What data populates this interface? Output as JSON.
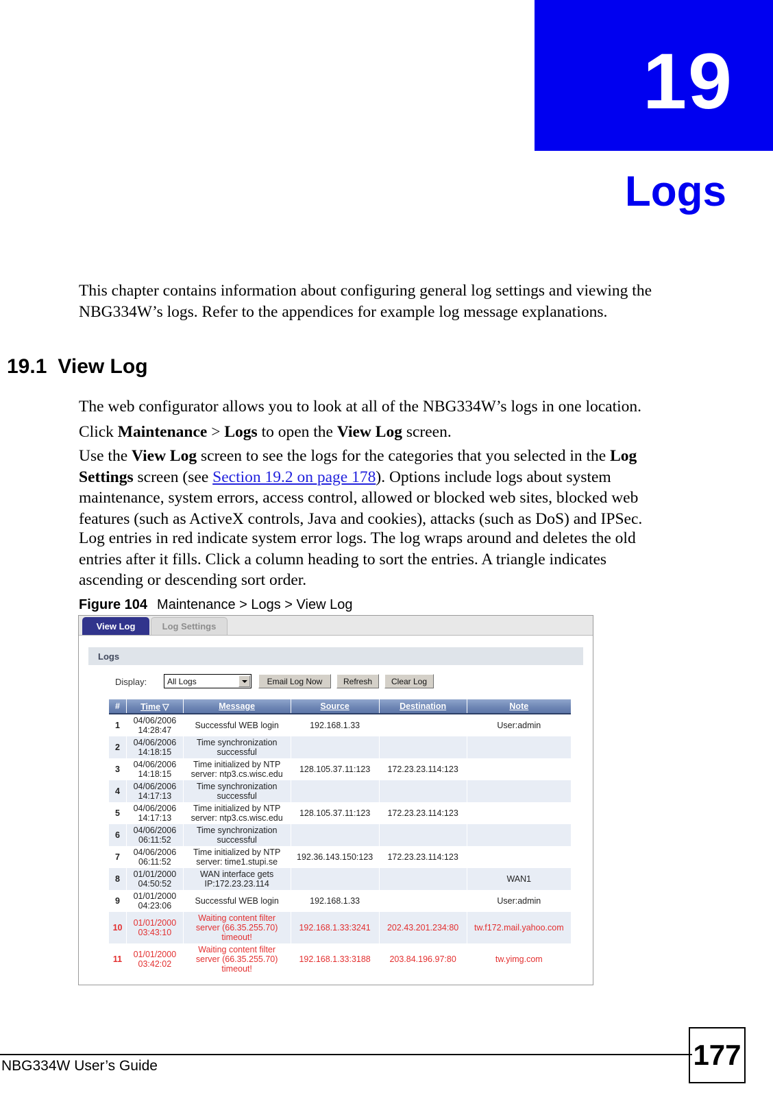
{
  "chapter": {
    "number": "19",
    "title": "Logs",
    "badge_color": "#0000f0"
  },
  "intro": "This chapter contains information about configuring general log settings and viewing the NBG334W’s logs. Refer to the appendices for example log message explanations.",
  "section": {
    "number": "19.1",
    "title": "View Log"
  },
  "paragraphs": {
    "p1": "The web configurator allows you to look at all of the NBG334W’s logs in one location.",
    "p2_a": "Click ",
    "p2_b": "Maintenance",
    "p2_c": " > ",
    "p2_d": "Logs",
    "p2_e": " to open the ",
    "p2_f": "View Log",
    "p2_g": " screen.",
    "p3_a": "Use the ",
    "p3_b": "View Log",
    "p3_c": " screen to see the logs for the categories that you selected in the ",
    "p3_d": "Log Settings",
    "p3_e": " screen (see ",
    "p3_link": "Section 19.2 on page 178",
    "p3_f": "). Options include logs about system maintenance, system errors, access control, allowed or blocked web sites, blocked web features (such as ActiveX controls, Java and cookies), attacks (such as DoS) and IPSec.",
    "p4": "Log entries in red indicate system error logs. The log wraps around and deletes the old entries after it fills. Click a column heading to sort the entries. A triangle indicates ascending or descending sort order."
  },
  "figure": {
    "label": "Figure 104",
    "caption": "Maintenance > Logs > View Log"
  },
  "screen": {
    "tabs": [
      {
        "label": "View Log",
        "active": true
      },
      {
        "label": "Log Settings",
        "active": false
      }
    ],
    "panel_title": "Logs",
    "toolbar": {
      "display_label": "Display:",
      "display_value": "All Logs",
      "display_options": [
        "All Logs"
      ],
      "email_log_now": "Email Log Now",
      "refresh": "Refresh",
      "clear_log": "Clear Log"
    },
    "table": {
      "sort_column": "Time",
      "sort_caret": "▽",
      "headers": [
        "#",
        "Time",
        "Message",
        "Source",
        "Destination",
        "Note"
      ],
      "rows": [
        {
          "index": "1",
          "time": "04/06/2006\n14:28:47",
          "message": "Successful WEB login",
          "source": "192.168.1.33",
          "destination": "",
          "note": "User:admin",
          "error": false
        },
        {
          "index": "2",
          "time": "04/06/2006\n14:18:15",
          "message": "Time synchronization successful",
          "source": "",
          "destination": "",
          "note": "",
          "error": false
        },
        {
          "index": "3",
          "time": "04/06/2006\n14:18:15",
          "message": "Time initialized by NTP server: ntp3.cs.wisc.edu",
          "source": "128.105.37.11:123",
          "destination": "172.23.23.114:123",
          "note": "",
          "error": false
        },
        {
          "index": "4",
          "time": "04/06/2006\n14:17:13",
          "message": "Time synchronization successful",
          "source": "",
          "destination": "",
          "note": "",
          "error": false
        },
        {
          "index": "5",
          "time": "04/06/2006\n14:17:13",
          "message": "Time initialized by NTP server: ntp3.cs.wisc.edu",
          "source": "128.105.37.11:123",
          "destination": "172.23.23.114:123",
          "note": "",
          "error": false
        },
        {
          "index": "6",
          "time": "04/06/2006\n06:11:52",
          "message": "Time synchronization successful",
          "source": "",
          "destination": "",
          "note": "",
          "error": false
        },
        {
          "index": "7",
          "time": "04/06/2006\n06:11:52",
          "message": "Time initialized by NTP server: time1.stupi.se",
          "source": "192.36.143.150:123",
          "destination": "172.23.23.114:123",
          "note": "",
          "error": false
        },
        {
          "index": "8",
          "time": "01/01/2000\n04:50:52",
          "message": "WAN interface gets IP:172.23.23.114",
          "source": "",
          "destination": "",
          "note": "WAN1",
          "error": false
        },
        {
          "index": "9",
          "time": "01/01/2000\n04:23:06",
          "message": "Successful WEB login",
          "source": "192.168.1.33",
          "destination": "",
          "note": "User:admin",
          "error": false
        },
        {
          "index": "10",
          "time": "01/01/2000\n03:43:10",
          "message": "Waiting content filter server (66.35.255.70) timeout!",
          "source": "192.168.1.33:3241",
          "destination": "202.43.201.234:80",
          "note": "tw.f172.mail.yahoo.com",
          "error": true
        },
        {
          "index": "11",
          "time": "01/01/2000\n03:42:02",
          "message": "Waiting content filter server (66.35.255.70) timeout!",
          "source": "192.168.1.33:3188",
          "destination": "203.84.196.97:80",
          "note": "tw.yimg.com",
          "error": true
        }
      ]
    }
  },
  "footer": {
    "guide": "NBG334W User’s Guide",
    "page": "177"
  }
}
